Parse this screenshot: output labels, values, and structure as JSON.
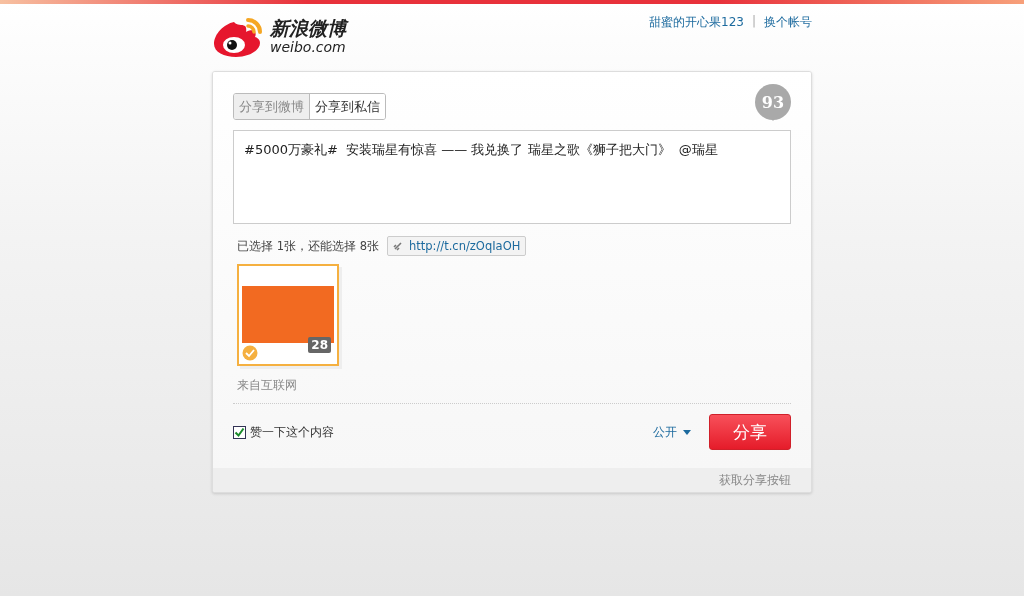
{
  "header": {
    "logo_text": "新浪微博",
    "logo_domain": "weibo.com",
    "username": "甜蜜的开心果123",
    "separator": "|",
    "switch_account": "换个帐号"
  },
  "share": {
    "tabs": [
      {
        "label": "分享到微博",
        "selected": true
      },
      {
        "label": "分享到私信",
        "selected": false
      }
    ],
    "char_count": "93",
    "message": "#5000万豪礼#  安装瑞星有惊喜 —— 我兑换了 瑞星之歌《狮子把大门》  @瑞星",
    "selection_info": "已选择 1张，还能选择 8张",
    "short_link": "http://t.cn/zOqIaOH",
    "images": [
      {
        "count": "28",
        "selected": true
      }
    ],
    "source": "来自互联网",
    "like": {
      "label": "赞一下这个内容",
      "checked": true
    },
    "visibility": "公开",
    "submit": "分享",
    "footer_link": "获取分享按钮"
  }
}
